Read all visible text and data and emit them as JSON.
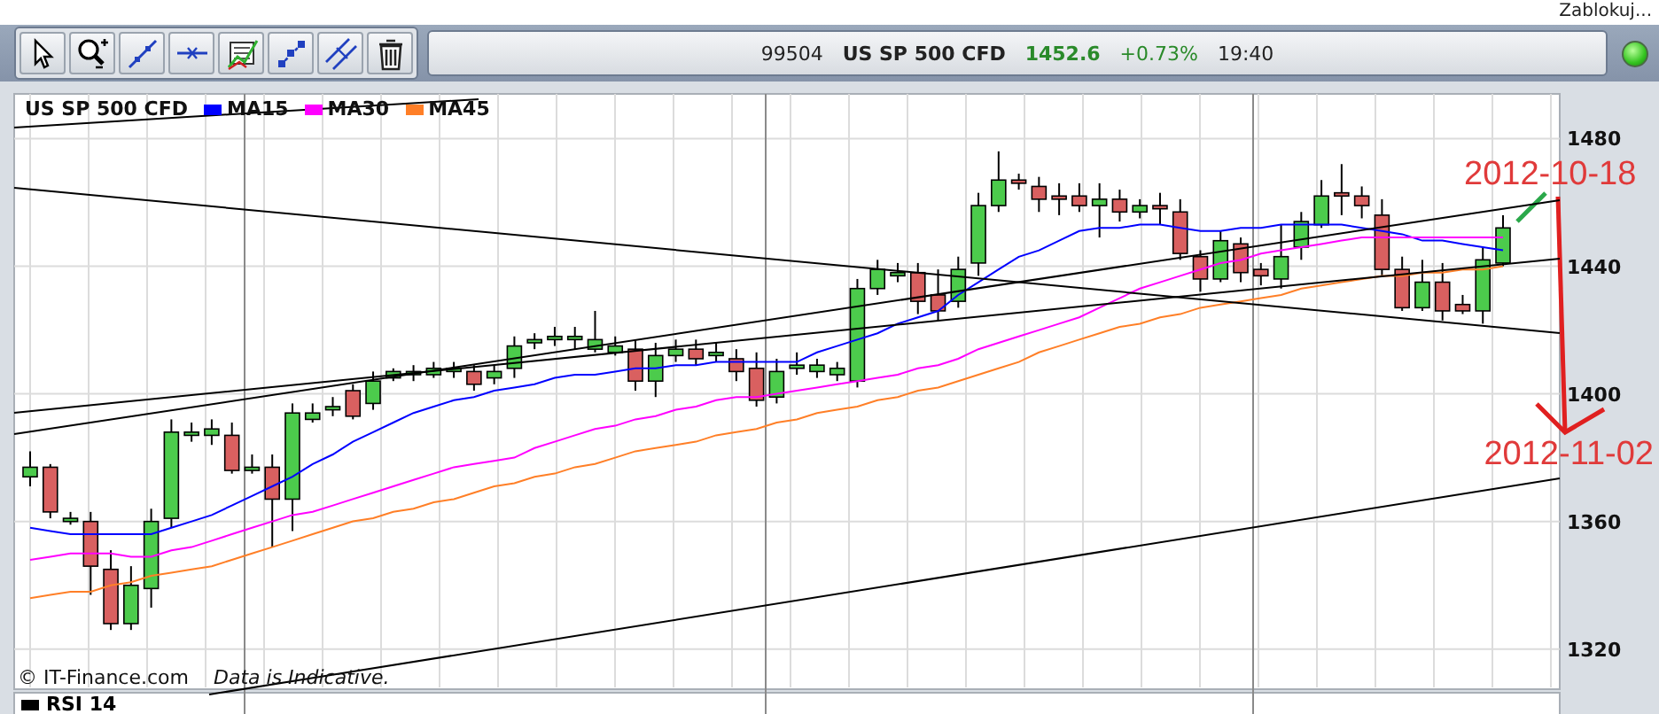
{
  "top_bar": {
    "link": "Zablokuj..."
  },
  "toolbar": {
    "tools": [
      {
        "kind": "cursor"
      },
      {
        "kind": "zoom"
      },
      {
        "kind": "trendline"
      },
      {
        "kind": "hline"
      },
      {
        "kind": "indicator"
      },
      {
        "kind": "diagonal"
      },
      {
        "kind": "parallel"
      },
      {
        "kind": "trash"
      }
    ]
  },
  "quote": {
    "code": "99504",
    "symbol": "US SP 500 CFD",
    "price": "1452.6",
    "change": "+0.73%",
    "time": "19:40"
  },
  "chart": {
    "legend": {
      "label": "US SP 500 CFD"
    },
    "price_panel": {
      "chart_data": {
        "type": "candlestick",
        "grid": true,
        "ylim": [
          1308,
          1494
        ],
        "yticks": [
          1480,
          1440,
          1400,
          1360,
          1320
        ],
        "ohlc": [
          [
            1374,
            1382,
            1371,
            1377
          ],
          [
            1377,
            1378,
            1361,
            1363
          ],
          [
            1360,
            1363,
            1359,
            1361
          ],
          [
            1360,
            1363,
            1337,
            1346
          ],
          [
            1345,
            1351,
            1326,
            1328
          ],
          [
            1328,
            1346,
            1326,
            1340
          ],
          [
            1339,
            1364,
            1333,
            1360
          ],
          [
            1361,
            1392,
            1358,
            1388
          ],
          [
            1387,
            1391,
            1385,
            1388
          ],
          [
            1387,
            1392,
            1384,
            1389
          ],
          [
            1387,
            1391,
            1375,
            1376
          ],
          [
            1376,
            1381,
            1375,
            1377
          ],
          [
            1377,
            1381,
            1352,
            1367
          ],
          [
            1367,
            1397,
            1357,
            1394
          ],
          [
            1392,
            1397,
            1391,
            1394
          ],
          [
            1395,
            1399,
            1393,
            1396
          ],
          [
            1401,
            1403,
            1392,
            1393
          ],
          [
            1397,
            1407,
            1395,
            1404
          ],
          [
            1405,
            1408,
            1404,
            1407
          ],
          [
            1406,
            1409,
            1404,
            1407
          ],
          [
            1406,
            1410,
            1405,
            1408
          ],
          [
            1407,
            1410,
            1405,
            1408
          ],
          [
            1407,
            1409,
            1401,
            1403
          ],
          [
            1405,
            1409,
            1403,
            1407
          ],
          [
            1408,
            1418,
            1405,
            1415
          ],
          [
            1416,
            1419,
            1414,
            1417
          ],
          [
            1417,
            1421,
            1415,
            1418
          ],
          [
            1417,
            1421,
            1414,
            1418
          ],
          [
            1414,
            1426,
            1413,
            1417
          ],
          [
            1413,
            1418,
            1412,
            1415
          ],
          [
            1414,
            1417,
            1401,
            1404
          ],
          [
            1404,
            1416,
            1399,
            1412
          ],
          [
            1412,
            1417,
            1410,
            1414
          ],
          [
            1414,
            1417,
            1409,
            1411
          ],
          [
            1412,
            1416,
            1410,
            1413
          ],
          [
            1411,
            1414,
            1404,
            1407
          ],
          [
            1408,
            1413,
            1396,
            1398
          ],
          [
            1399,
            1411,
            1397,
            1407
          ],
          [
            1408,
            1413,
            1406,
            1409
          ],
          [
            1407,
            1411,
            1405,
            1409
          ],
          [
            1406,
            1410,
            1404,
            1408
          ],
          [
            1404,
            1436,
            1402,
            1433
          ],
          [
            1433,
            1442,
            1431,
            1439
          ],
          [
            1437,
            1441,
            1435,
            1438
          ],
          [
            1438,
            1441,
            1425,
            1429
          ],
          [
            1431,
            1439,
            1423,
            1426
          ],
          [
            1429,
            1443,
            1427,
            1439
          ],
          [
            1441,
            1463,
            1437,
            1459
          ],
          [
            1459,
            1476,
            1457,
            1467
          ],
          [
            1467,
            1469,
            1464,
            1466
          ],
          [
            1465,
            1468,
            1457,
            1461
          ],
          [
            1462,
            1466,
            1456,
            1461
          ],
          [
            1462,
            1466,
            1457,
            1459
          ],
          [
            1459,
            1466,
            1449,
            1461
          ],
          [
            1461,
            1464,
            1454,
            1457
          ],
          [
            1457,
            1461,
            1455,
            1459
          ],
          [
            1459,
            1463,
            1453,
            1458
          ],
          [
            1457,
            1461,
            1442,
            1444
          ],
          [
            1443,
            1445,
            1432,
            1436
          ],
          [
            1436,
            1451,
            1435,
            1448
          ],
          [
            1447,
            1449,
            1435,
            1438
          ],
          [
            1439,
            1441,
            1434,
            1437
          ],
          [
            1436,
            1453,
            1433,
            1443
          ],
          [
            1446,
            1457,
            1442,
            1454
          ],
          [
            1453,
            1467,
            1452,
            1462
          ],
          [
            1463,
            1472,
            1456,
            1462
          ],
          [
            1462,
            1465,
            1455,
            1459
          ],
          [
            1456,
            1461,
            1437,
            1439
          ],
          [
            1439,
            1443,
            1426,
            1427
          ],
          [
            1427,
            1442,
            1426,
            1435
          ],
          [
            1435,
            1441,
            1423,
            1426
          ],
          [
            1428,
            1431,
            1425,
            1426
          ],
          [
            1426,
            1446,
            1422,
            1442
          ],
          [
            1441,
            1456,
            1440,
            1452
          ]
        ],
        "series": [
          {
            "name": "MA15",
            "type": "line",
            "color": "#0000ff",
            "values": [
              1358,
              1357,
              1356,
              1356,
              1356,
              1356,
              1356,
              1358,
              1360,
              1362,
              1365,
              1368,
              1371,
              1374,
              1378,
              1381,
              1385,
              1388,
              1391,
              1394,
              1396,
              1398,
              1399,
              1401,
              1402,
              1403,
              1405,
              1406,
              1406,
              1407,
              1408,
              1408,
              1409,
              1409,
              1410,
              1410,
              1410,
              1410,
              1410,
              1413,
              1415,
              1417,
              1419,
              1422,
              1424,
              1426,
              1431,
              1435,
              1439,
              1443,
              1445,
              1448,
              1451,
              1452,
              1452,
              1453,
              1453,
              1452,
              1451,
              1451,
              1452,
              1452,
              1453,
              1453,
              1453,
              1453,
              1452,
              1451,
              1450,
              1448,
              1448,
              1447,
              1446,
              1445
            ]
          },
          {
            "name": "MA30",
            "type": "line",
            "color": "#ff00ff",
            "values": [
              1348,
              1349,
              1350,
              1350,
              1350,
              1349,
              1349,
              1351,
              1352,
              1354,
              1356,
              1358,
              1360,
              1362,
              1363,
              1365,
              1367,
              1369,
              1371,
              1373,
              1375,
              1377,
              1378,
              1379,
              1380,
              1383,
              1385,
              1387,
              1389,
              1390,
              1392,
              1393,
              1395,
              1396,
              1398,
              1399,
              1399,
              1400,
              1401,
              1402,
              1403,
              1404,
              1405,
              1406,
              1408,
              1409,
              1411,
              1414,
              1416,
              1418,
              1420,
              1422,
              1424,
              1427,
              1430,
              1433,
              1435,
              1437,
              1439,
              1441,
              1442,
              1444,
              1445,
              1446,
              1447,
              1448,
              1449,
              1449,
              1449,
              1449,
              1449,
              1449,
              1449,
              1449
            ]
          },
          {
            "name": "MA45",
            "type": "line",
            "color": "#ff7f27",
            "values": [
              1336,
              1337,
              1338,
              1338,
              1340,
              1341,
              1343,
              1344,
              1345,
              1346,
              1348,
              1350,
              1352,
              1354,
              1356,
              1358,
              1360,
              1361,
              1363,
              1364,
              1366,
              1367,
              1369,
              1371,
              1372,
              1374,
              1375,
              1377,
              1378,
              1380,
              1382,
              1383,
              1384,
              1385,
              1387,
              1388,
              1389,
              1391,
              1392,
              1394,
              1395,
              1396,
              1398,
              1399,
              1401,
              1402,
              1404,
              1406,
              1408,
              1410,
              1413,
              1415,
              1417,
              1419,
              1421,
              1422,
              1424,
              1425,
              1427,
              1428,
              1429,
              1430,
              1431,
              1433,
              1434,
              1435,
              1436,
              1437,
              1437,
              1438,
              1438,
              1439,
              1439,
              1440
            ]
          }
        ]
      }
    },
    "annotations": [
      "2012-10-18",
      "2012-11-02"
    ],
    "footer": {
      "copyright": "© IT-Finance.com",
      "notice": "Data is Indicative."
    },
    "rsi_panel": {
      "label": "RSI 14"
    }
  }
}
